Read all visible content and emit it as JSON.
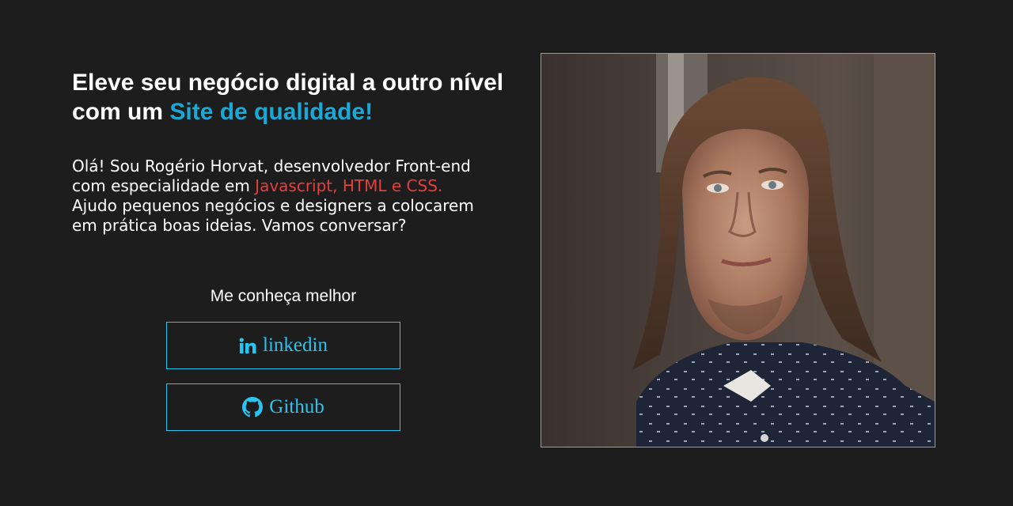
{
  "hero": {
    "headline_part1": "Eleve seu negócio digital a outro nível com um ",
    "headline_accent": "Site de qualidade!",
    "intro_part1": "Olá! Sou Rogério Horvat, desenvolvedor Front-end com especialidade em ",
    "intro_skills": "Javascript, HTML e CSS.",
    "intro_part2": " Ajudo pequenos negócios e designers a colocarem em prática boas ideias. Vamos conversar?"
  },
  "links": {
    "title": "Me conheça melhor",
    "items": [
      {
        "label": "linkedin",
        "icon": "linkedin-icon"
      },
      {
        "label": "Github",
        "icon": "github-icon"
      }
    ]
  },
  "colors": {
    "background": "#1d1d1d",
    "accent_blue": "#1aa9d6",
    "button_blue": "#29c4ef",
    "skills_red": "#e53f3f",
    "text": "#ffffff"
  }
}
